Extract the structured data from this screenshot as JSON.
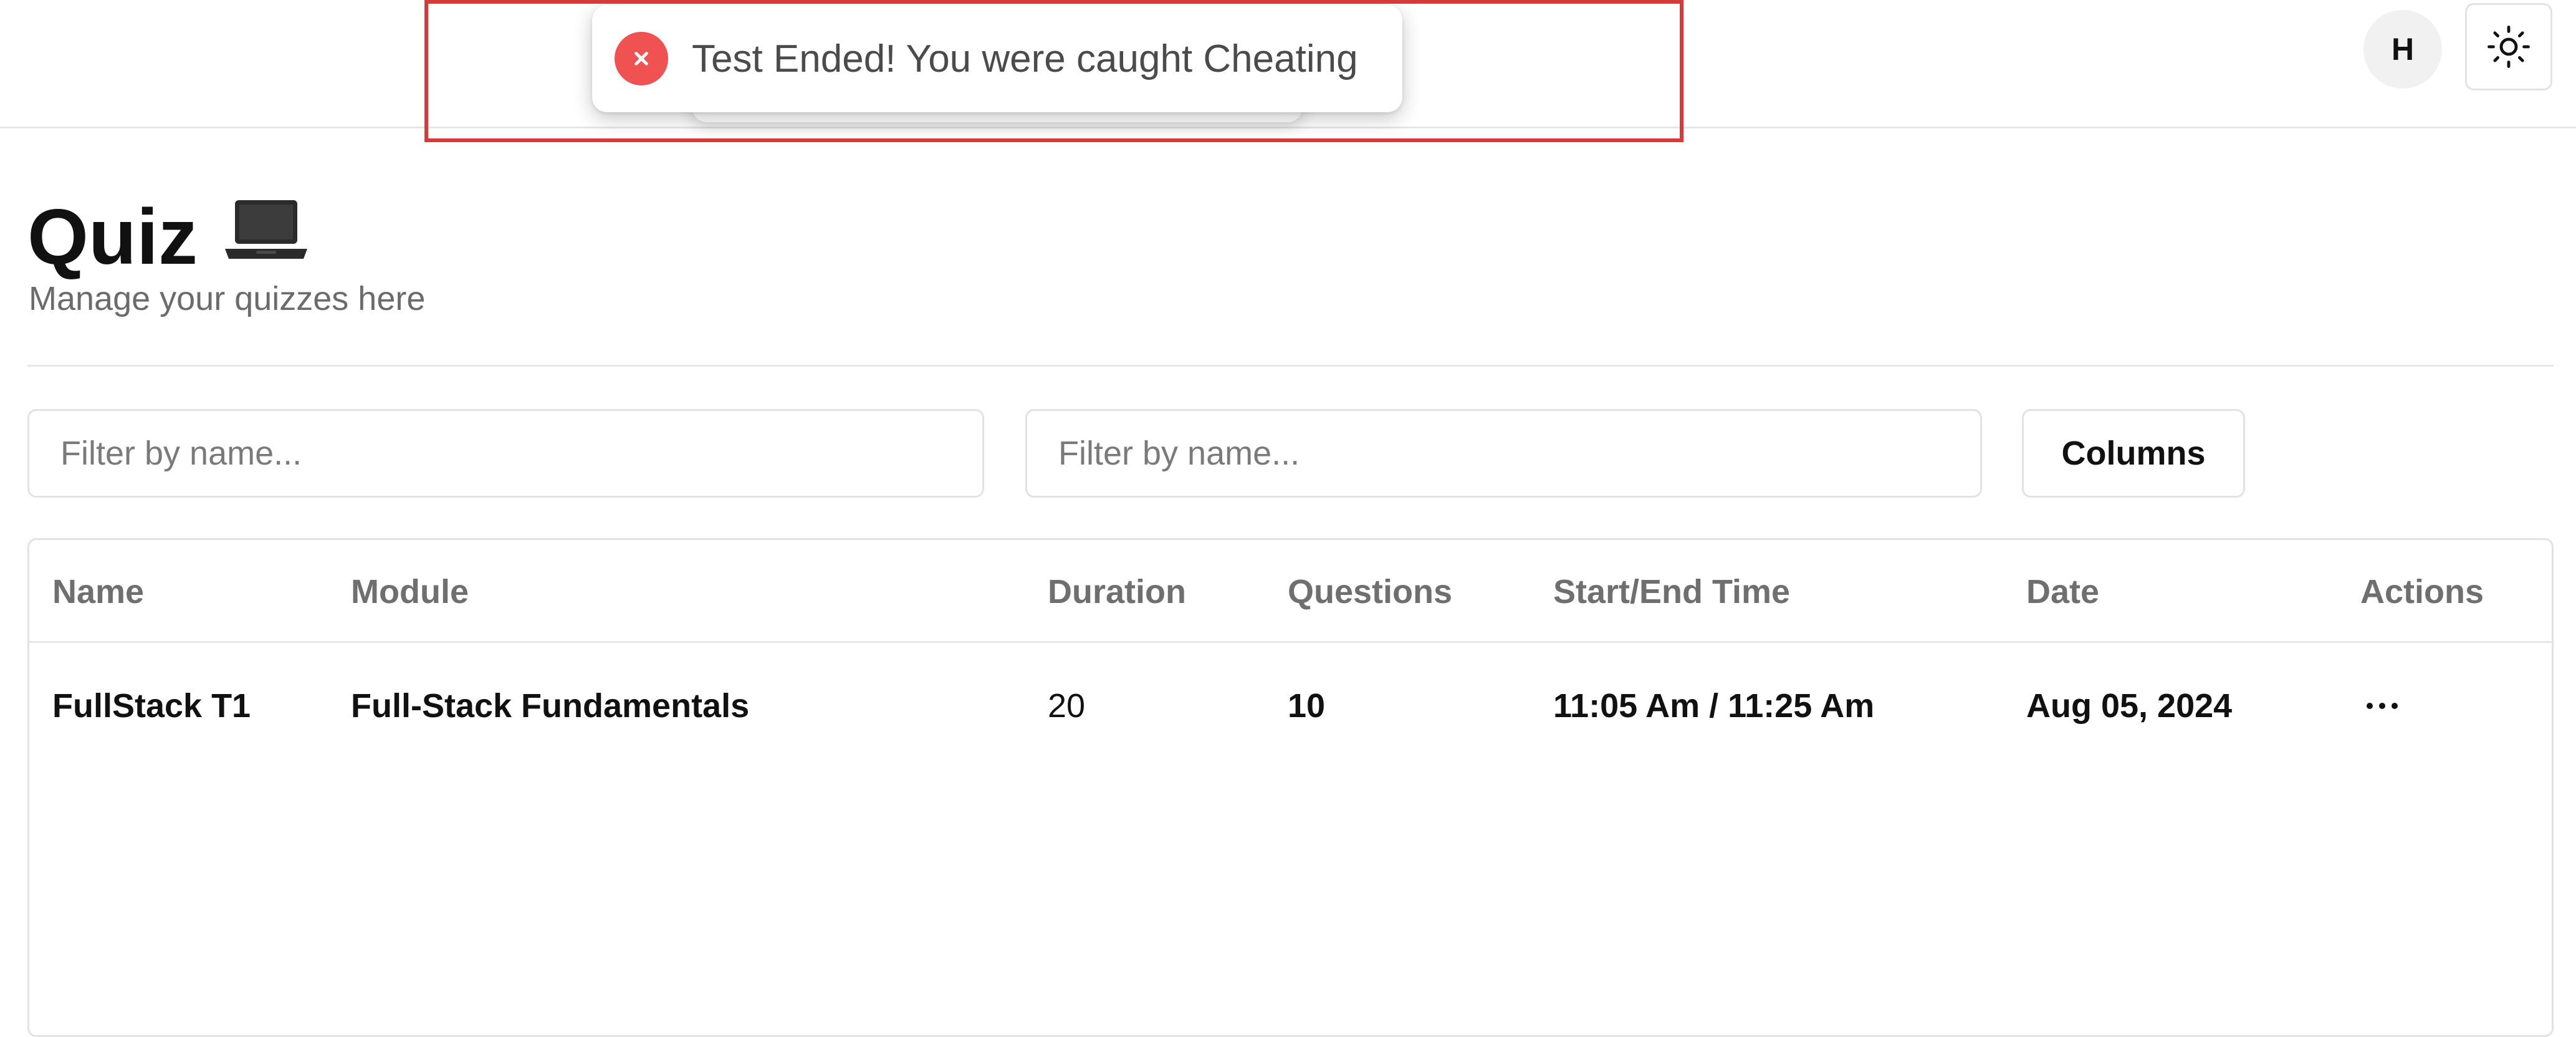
{
  "topbar": {
    "avatar_initial": "H",
    "theme_toggle_icon": "sun-icon"
  },
  "toast": {
    "message": "Test Ended! You were caught Cheating",
    "icon": "error-x-icon",
    "icon_color": "#f05252",
    "highlight_color": "#d63a3a"
  },
  "page": {
    "title": "Quiz",
    "title_icon": "laptop-icon",
    "subtitle": "Manage your quizzes here"
  },
  "filters": {
    "name_placeholder": "Filter by name...",
    "module_placeholder": "Filter by name...",
    "columns_label": "Columns"
  },
  "table": {
    "headers": [
      "Name",
      "Module",
      "Duration",
      "Questions",
      "Start/End Time",
      "Date",
      "Actions"
    ],
    "rows": [
      {
        "name": "FullStack T1",
        "module": "Full-Stack Fundamentals",
        "duration": "20",
        "questions": "10",
        "start_end_time": "11:05 Am / 11:25 Am",
        "date": "Aug 05, 2024",
        "actions_icon": "more-horizontal-icon"
      }
    ]
  }
}
